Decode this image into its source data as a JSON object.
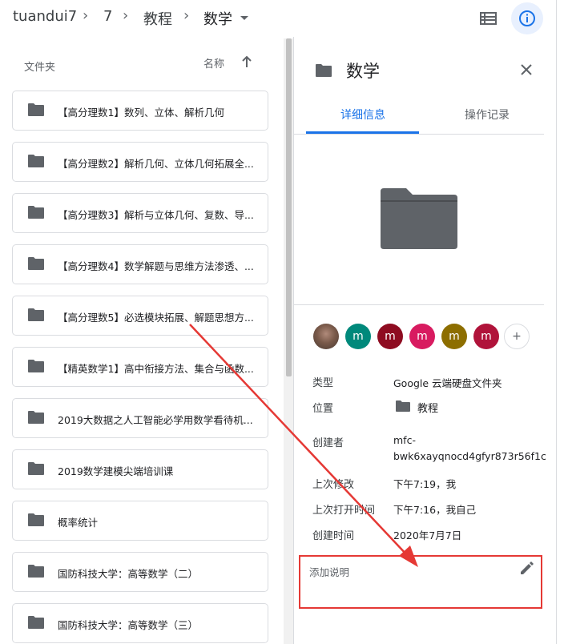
{
  "breadcrumb": {
    "items": [
      "tuandui7",
      "7",
      "教程"
    ],
    "current": "数学",
    "separator": "›"
  },
  "list": {
    "header_label": "文件夹",
    "sort_label": "名称",
    "folders": [
      "【高分理数1】数列、立体、解析几何",
      "【高分理数2】解析几何、立体几何拓展全...",
      "【高分理数3】解析与立体几何、复数、导...",
      "【高分理数4】数学解题与思维方法渗透、...",
      "【高分理数5】必选模块拓展、解题思想方...",
      "【精英数学1】高中衔接方法、集合与函数...",
      "2019大数据之人工智能必学用数学看待机...",
      "2019数学建模尖端培训课",
      "概率统计",
      "国防科技大学：高等数学（二）",
      "国防科技大学：高等数学（三）"
    ]
  },
  "details": {
    "title": "数学",
    "tabs": [
      "详细信息",
      "操作记录"
    ],
    "avatars": [
      {
        "kind": "photo",
        "letter": "",
        "color": "#7a5a4a"
      },
      {
        "kind": "letter",
        "letter": "m",
        "color": "#00897b"
      },
      {
        "kind": "letter",
        "letter": "m",
        "color": "#8e0c21"
      },
      {
        "kind": "letter",
        "letter": "m",
        "color": "#d81b60"
      },
      {
        "kind": "letter",
        "letter": "m",
        "color": "#8d6e00"
      },
      {
        "kind": "letter",
        "letter": "m",
        "color": "#b0133a"
      }
    ],
    "more_label": "+",
    "type_label": "类型",
    "type_value": "Google 云端硬盘文件夹",
    "location_label": "位置",
    "location_value": "教程",
    "owner_label": "创建者",
    "owner_value_line1": "mfc-",
    "owner_value_line2": "bwk6xayqnocd4gfyr873r56f1c",
    "modified_label": "上次修改",
    "modified_value": "下午7:19，我",
    "opened_label": "上次打开时间",
    "opened_value": "下午7:16，我自己",
    "created_label": "创建时间",
    "created_value": "2020年7月7日",
    "description_placeholder": "添加说明"
  },
  "colors": {
    "accent": "#1a73e8",
    "annotation": "#e53935",
    "folder_icon": "#5f6368"
  }
}
